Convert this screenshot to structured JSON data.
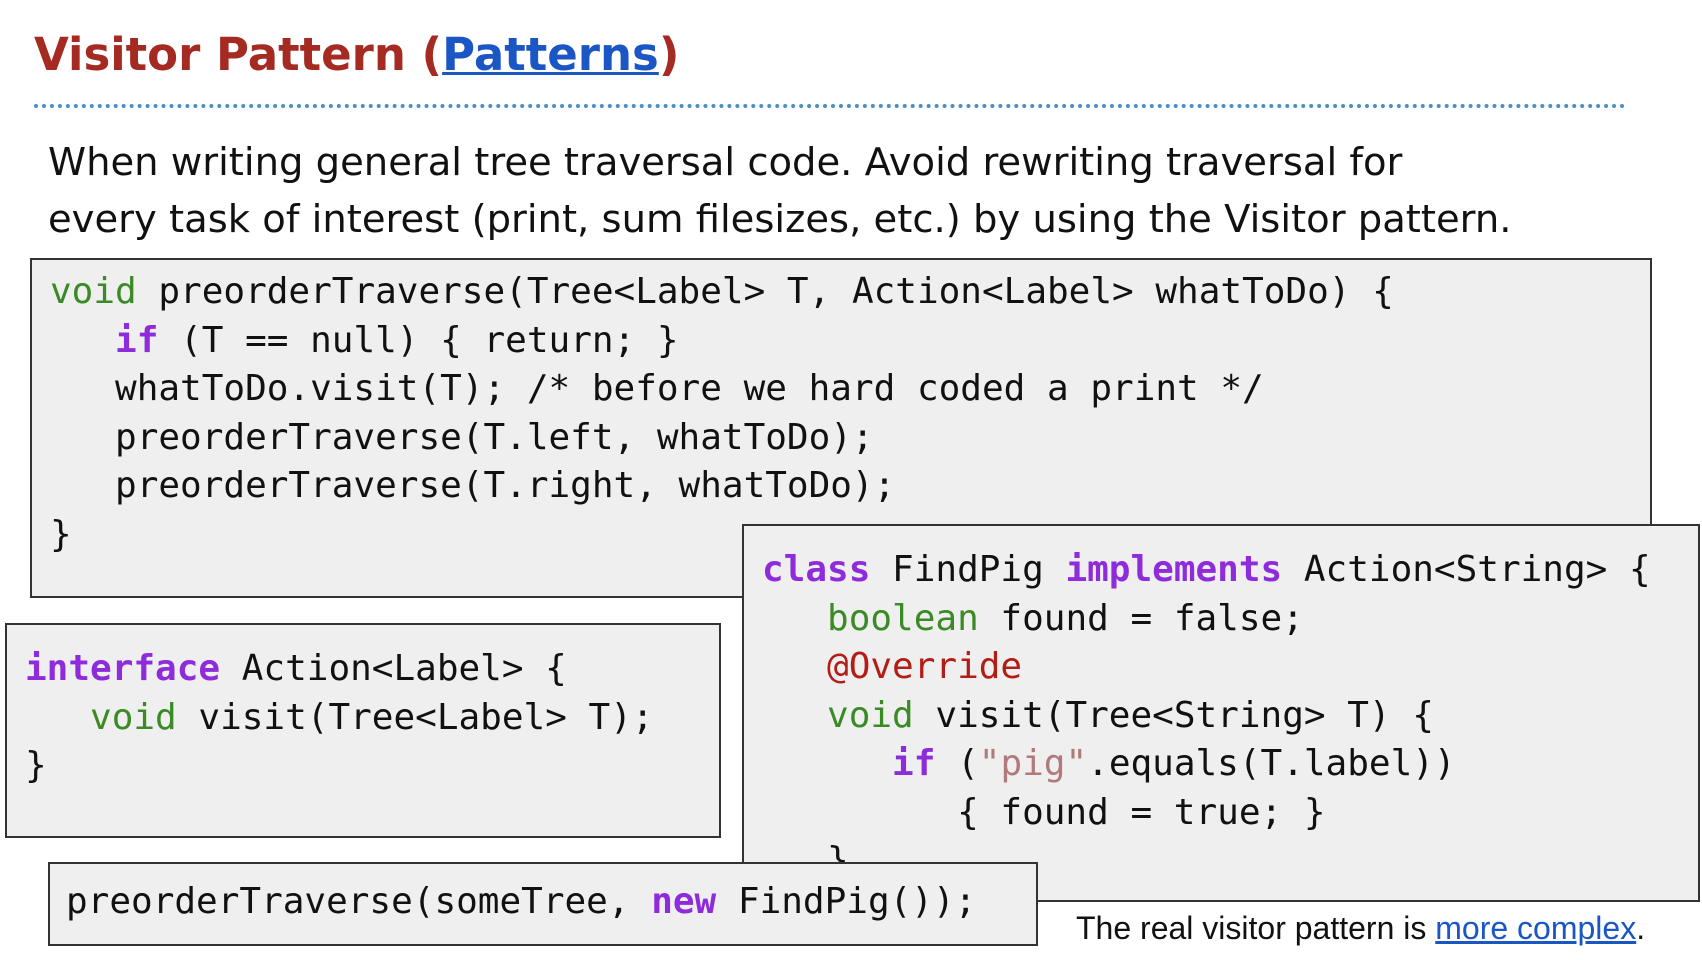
{
  "title": {
    "prefix": "Visitor Pattern (",
    "link": "Patterns",
    "suffix": ")"
  },
  "intro": {
    "line1": "When writing general tree traversal code. Avoid rewriting traversal for",
    "line2": "every task of interest (print, sum filesizes, etc.) by using the Visitor pattern."
  },
  "code_traverse": {
    "l1_kw": "void",
    "l1_rest": " preorderTraverse(Tree<Label> T, Action<Label> whatToDo) {",
    "l2_indent": "   ",
    "l2_kw": "if",
    "l2_rest": " (T == null) { return; }",
    "l3": "   whatToDo.visit(T); /* before we hard coded a print */",
    "l4": "   preorderTraverse(T.left, whatToDo);",
    "l5": "   preorderTraverse(T.right, whatToDo);",
    "l6": "}"
  },
  "code_interface": {
    "l1_kw": "interface",
    "l1_rest": " Action<Label> {",
    "l2_indent": "   ",
    "l2_kw": "void",
    "l2_rest": " visit(Tree<Label> T);",
    "l3": "}"
  },
  "code_findpig": {
    "l1_kw1": "class",
    "l1_mid": " FindPig ",
    "l1_kw2": "implements",
    "l1_rest": " Action<String> {",
    "l2_indent": "   ",
    "l2_kw": "boolean",
    "l2_rest": " found = false;",
    "l3_indent": "   ",
    "l3_anno": "@Override",
    "l4_indent": "   ",
    "l4_kw": "void",
    "l4_rest": " visit(Tree<String> T) {",
    "l5_indent": "      ",
    "l5_kw": "if",
    "l5_open": " (",
    "l5_str": "\"pig\"",
    "l5_rest": ".equals(T.label))",
    "l6": "         { found = true; }",
    "l7": "   }"
  },
  "code_call": {
    "pre": "preorderTraverse(someTree, ",
    "kw": "new",
    "post": " FindPig());"
  },
  "footnote": {
    "text": "The real visitor pattern is ",
    "link": "more complex",
    "end": "."
  },
  "colors": {
    "title": "#a52a22",
    "link": "#1a56c4",
    "keyword_purple": "#8e2bdb",
    "keyword_green": "#3a8a26",
    "annotation": "#b21d16",
    "string": "#b07a7a",
    "code_bg": "#efefef"
  }
}
